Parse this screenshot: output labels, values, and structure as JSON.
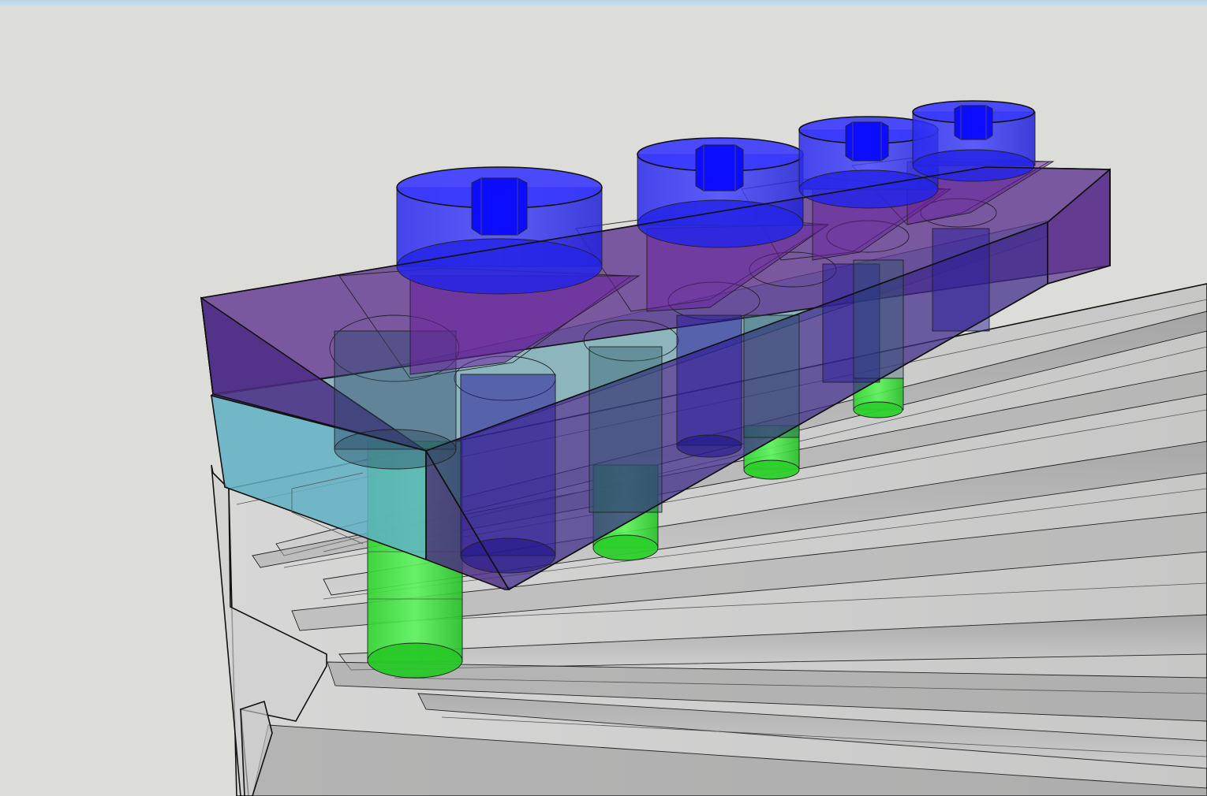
{
  "viewport": {
    "background_color": "#dcdcd8",
    "top_strip_color": "#c4dbef"
  },
  "colors": {
    "clamp_block": "#5a2d82",
    "spacer_plate": "#5fb0c4",
    "screw": "#2a2af0",
    "tnut": "#22dd22",
    "extrusion": "#bdbdbd",
    "edge": "#111111"
  },
  "model": {
    "components": [
      {
        "kind": "clamp-block",
        "color_key": "clamp_block",
        "count": 1
      },
      {
        "kind": "spacer-plate",
        "color_key": "spacer_plate",
        "count": 1
      },
      {
        "kind": "socket-head-screw",
        "color_key": "screw",
        "count": 4
      },
      {
        "kind": "t-nut-post",
        "color_key": "tnut",
        "count": 4
      },
      {
        "kind": "aluminum-extrusion",
        "color_key": "extrusion",
        "count": 1
      }
    ]
  }
}
